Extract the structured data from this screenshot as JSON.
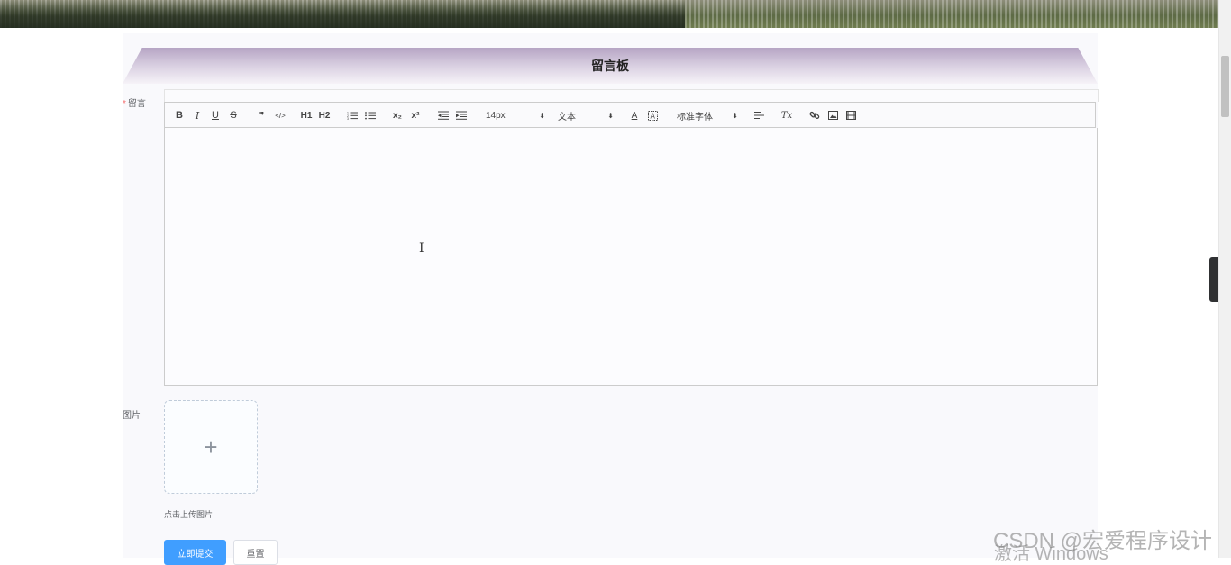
{
  "panel": {
    "title": "留言板"
  },
  "form": {
    "message_label": "留言",
    "required_mark": "*",
    "image_label": "图片",
    "upload_plus": "+",
    "upload_hint": "点击上传图片",
    "submit_label": "立即提交",
    "reset_label": "重置"
  },
  "toolbar": {
    "bold": "B",
    "italic": "I",
    "underline": "U",
    "strike": "S",
    "blockquote": "❞",
    "code": "</>",
    "h1": "H1",
    "h2": "H2",
    "subscript": "x₂",
    "superscript": "x²",
    "size_value": "14px",
    "header_value": "文本",
    "color_icon": "A",
    "font_value": "标准字体",
    "clean_icon": "Tx",
    "picker_arrow": "⬍"
  },
  "side_toggle": {
    "icon": "‹"
  },
  "editor": {
    "cursor": "I"
  },
  "watermarks": {
    "csdn": "CSDN @宏爱程序设计",
    "windows": "激活 Windows"
  },
  "colors": {
    "primary": "#409eff",
    "required": "#f56c6c",
    "title_gradient_top": "#b6a5c4"
  }
}
